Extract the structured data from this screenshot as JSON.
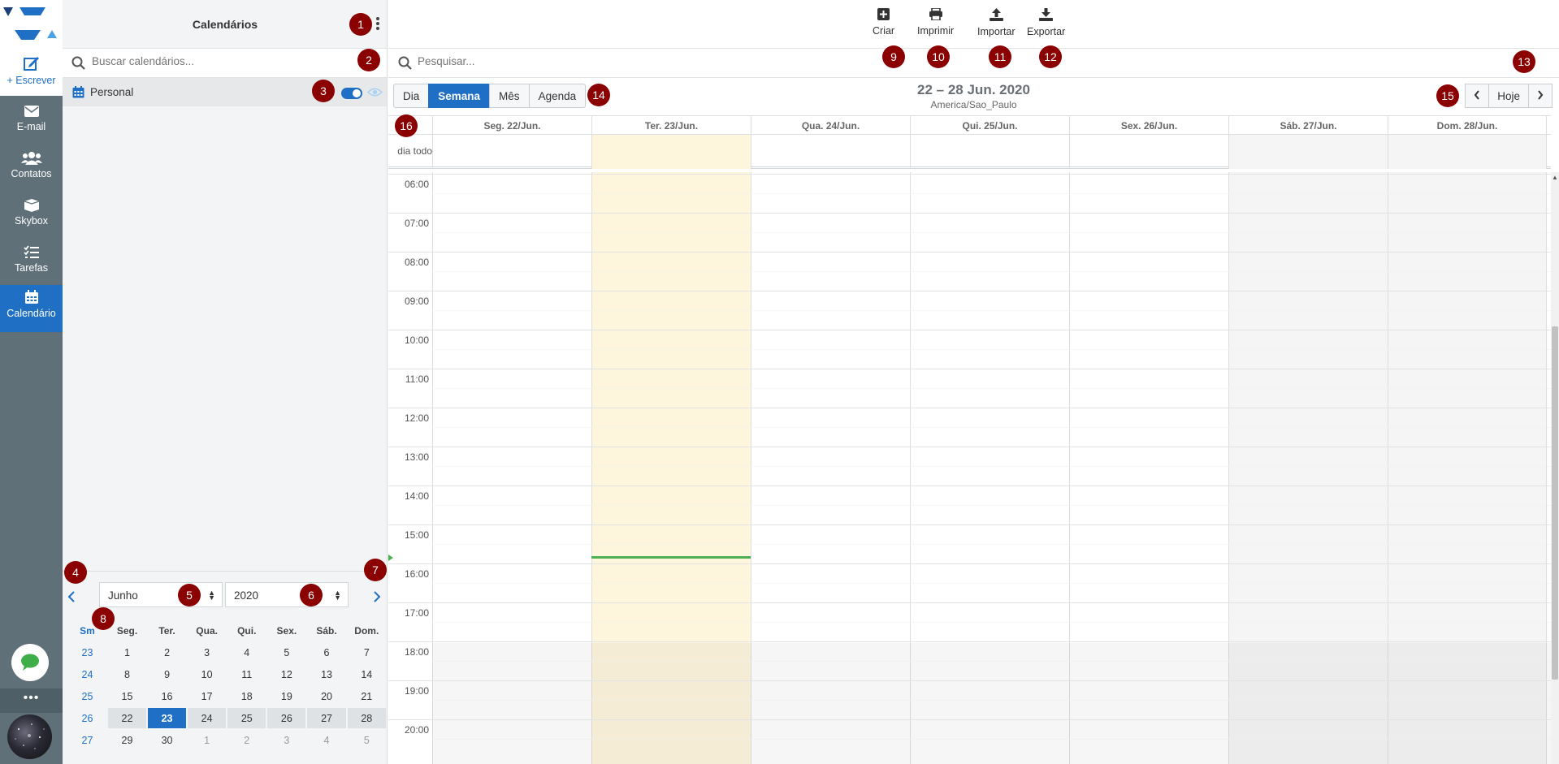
{
  "rail": {
    "compose_label": "+ Escrever",
    "items": [
      {
        "label": "E-mail",
        "icon": "mail-icon"
      },
      {
        "label": "Contatos",
        "icon": "contacts-icon"
      },
      {
        "label": "Skybox",
        "icon": "skybox-icon"
      },
      {
        "label": "Tarefas",
        "icon": "tasks-icon"
      },
      {
        "label": "Calendário",
        "icon": "calendar-icon",
        "active": true
      }
    ],
    "more_label": "•••"
  },
  "panel": {
    "title": "Calendários",
    "search_placeholder": "Buscar calendários...",
    "calendars": [
      {
        "name": "Personal",
        "enabled": true
      }
    ]
  },
  "mini_calendar": {
    "month": "Junho",
    "year": "2020",
    "week_header": "Sm",
    "weekdays": [
      "Seg.",
      "Ter.",
      "Qua.",
      "Qui.",
      "Sex.",
      "Sáb.",
      "Dom."
    ],
    "weeks": [
      {
        "wk": "23",
        "days": [
          "1",
          "2",
          "3",
          "4",
          "5",
          "6",
          "7"
        ]
      },
      {
        "wk": "24",
        "days": [
          "8",
          "9",
          "10",
          "11",
          "12",
          "13",
          "14"
        ]
      },
      {
        "wk": "25",
        "days": [
          "15",
          "16",
          "17",
          "18",
          "19",
          "20",
          "21"
        ]
      },
      {
        "wk": "26",
        "days": [
          "22",
          "23",
          "24",
          "25",
          "26",
          "27",
          "28"
        ]
      },
      {
        "wk": "27",
        "days": [
          "29",
          "30",
          "1",
          "2",
          "3",
          "4",
          "5"
        ]
      }
    ],
    "today": "23"
  },
  "toolbar": {
    "create": "Criar",
    "print": "Imprimir",
    "import": "Importar",
    "export": "Exportar"
  },
  "main": {
    "search_placeholder": "Pesquisar...",
    "views": [
      "Dia",
      "Semana",
      "Mês",
      "Agenda"
    ],
    "active_view": "Semana",
    "range_title": "22 – 28 Jun. 2020",
    "timezone": "America/Sao_Paulo",
    "today_label": "Hoje",
    "prev_label": "‹",
    "next_label": "›",
    "allday_label": "dia todo",
    "day_headers": [
      "Seg. 22/Jun.",
      "Ter. 23/Jun.",
      "Qua. 24/Jun.",
      "Qui. 25/Jun.",
      "Sex. 26/Jun.",
      "Sáb. 27/Jun.",
      "Dom. 28/Jun."
    ],
    "hours": [
      "06:00",
      "07:00",
      "08:00",
      "09:00",
      "10:00",
      "11:00",
      "12:00",
      "13:00",
      "14:00",
      "15:00",
      "16:00",
      "17:00",
      "18:00",
      "19:00",
      "20:00"
    ]
  },
  "markers": [
    "1",
    "2",
    "3",
    "4",
    "5",
    "6",
    "7",
    "8",
    "9",
    "10",
    "11",
    "12",
    "13",
    "14",
    "15",
    "16"
  ],
  "colors": {
    "accent": "#1f6fc5",
    "rail": "#5f7079",
    "today_column": "#fdf5dc",
    "now_line": "#4caf50",
    "marker": "#8b0000"
  }
}
